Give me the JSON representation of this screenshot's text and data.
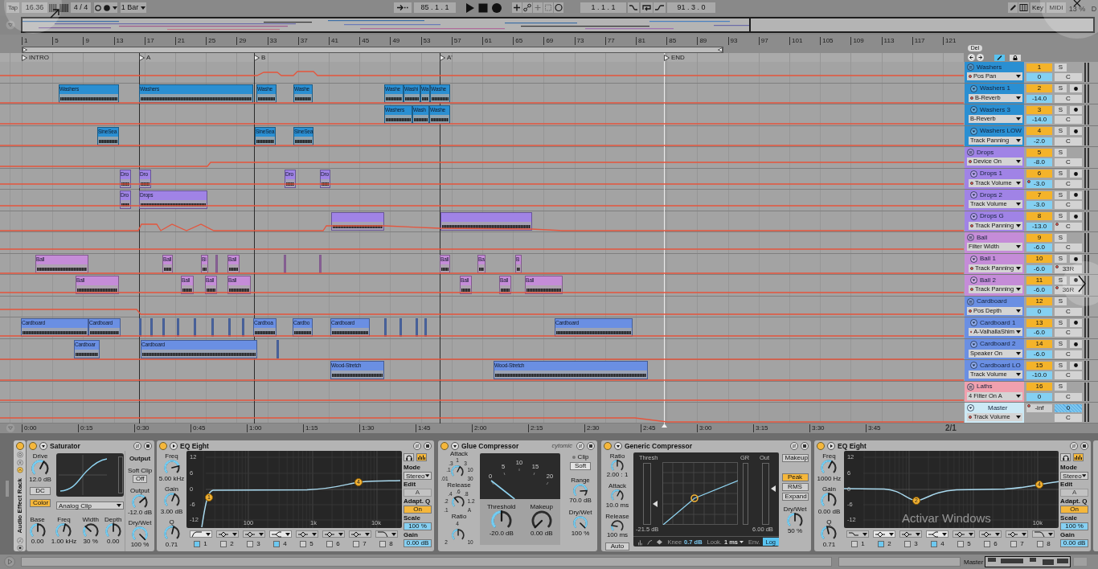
{
  "control_bar": {
    "tap": "Tap",
    "tempo": "16.36",
    "time_signature": "4 / 4",
    "quantization": "1 Bar",
    "position": "85 . 1 . 1",
    "loop_start": "1 . 1 . 1",
    "loop_length": "91 . 3 . 0",
    "key_button": "Key",
    "midi_button": "MIDI",
    "cpu_load": "13 %",
    "disk": "D"
  },
  "ruler": {
    "bars": [
      "1",
      "5",
      "9",
      "13",
      "17",
      "21",
      "25",
      "29",
      "33",
      "37",
      "41",
      "45",
      "49",
      "53",
      "57",
      "61",
      "65",
      "69",
      "73",
      "77",
      "81",
      "85",
      "89",
      "93",
      "97",
      "101",
      "105",
      "109",
      "113",
      "117",
      "121"
    ]
  },
  "locators": [
    "INTRO",
    "A",
    "B",
    "A'",
    "END"
  ],
  "header_tools": {
    "delete": "Del"
  },
  "tracks": [
    {
      "name": "Washers",
      "kind": "group",
      "color": "#2a8fd2",
      "automation": "Pos Pan",
      "automation_dot": true,
      "number": "1",
      "solo": "S",
      "volume": "0",
      "volume_dot": false,
      "pan": "C",
      "pan_dot": false
    },
    {
      "name": "Washers 1",
      "kind": "audio",
      "color": "#2a8fd2",
      "automation": "B-Reverb",
      "automation_dot": true,
      "number": "2",
      "solo": "S",
      "volume": "-14.0",
      "volume_dot": false,
      "pan": "C",
      "pan_dot": false,
      "clips": [
        {
          "kind": "clip",
          "name": "Washers"
        },
        {
          "kind": "clip",
          "name": "Washers"
        },
        {
          "kind": "clip",
          "name": "Washe"
        },
        {
          "kind": "clip",
          "name": "Washe"
        },
        {
          "kind": "clip",
          "name": "Washe"
        },
        {
          "kind": "clip",
          "name": "Washi"
        },
        {
          "kind": "clip",
          "name": "Wa"
        },
        {
          "kind": "clip",
          "name": "Washe"
        }
      ]
    },
    {
      "name": "Washers 3",
      "kind": "audio",
      "color": "#2a8fd2",
      "automation": "B-Reverb",
      "automation_dot": false,
      "number": "3",
      "solo": "S",
      "volume": "-14.0",
      "volume_dot": false,
      "pan": "C",
      "pan_dot": false,
      "clips": [
        {
          "kind": "clip",
          "name": "Washers"
        },
        {
          "kind": "clip",
          "name": "Wash"
        },
        {
          "kind": "clip",
          "name": "Washe"
        }
      ]
    },
    {
      "name": "Washers LOW",
      "kind": "audio",
      "color": "#2a8fd2",
      "automation": "Track Panning",
      "automation_dot": false,
      "number": "4",
      "solo": "S",
      "volume": "-2.0",
      "volume_dot": false,
      "pan": "C",
      "pan_dot": false,
      "clips": [
        {
          "kind": "clip",
          "name": "SineSea"
        },
        {
          "kind": "clip",
          "name": "SineSea"
        },
        {
          "kind": "clip",
          "name": "SineSea"
        }
      ]
    },
    {
      "name": "Drops",
      "kind": "group",
      "color": "#a083e6",
      "automation": "Device On",
      "automation_dot": true,
      "number": "5",
      "solo": "S",
      "volume": "-8.0",
      "volume_dot": false,
      "pan": "C",
      "pan_dot": false
    },
    {
      "name": "Drops 1",
      "kind": "audio",
      "color": "#a083e6",
      "automation": "Track Volume",
      "automation_dot": true,
      "number": "6",
      "solo": "S",
      "volume": "-3.0",
      "volume_dot": true,
      "pan": "C",
      "pan_dot": false,
      "clips": [
        {
          "kind": "clip",
          "name": "Dro"
        },
        {
          "kind": "clip",
          "name": "Dro"
        },
        {
          "kind": "clip",
          "name": "Dro"
        },
        {
          "kind": "clip",
          "name": "Dro"
        }
      ]
    },
    {
      "name": "Drops 2",
      "kind": "audio",
      "color": "#a083e6",
      "automation": "Track Volume",
      "automation_dot": false,
      "number": "7",
      "solo": "S",
      "volume": "-3.0",
      "volume_dot": false,
      "pan": "C",
      "pan_dot": false,
      "clips": [
        {
          "kind": "clip",
          "name": "Dro"
        },
        {
          "kind": "clip",
          "name": "Drops"
        }
      ]
    },
    {
      "name": "Drops G",
      "kind": "audio",
      "color": "#a083e6",
      "automation": "Track Panning",
      "automation_dot": true,
      "number": "8",
      "solo": "S",
      "volume": "-13.0",
      "volume_dot": false,
      "pan": "C",
      "pan_dot": true,
      "clips": [
        {
          "kind": "blank"
        },
        {
          "kind": "blank"
        }
      ]
    },
    {
      "name": "Ball",
      "kind": "group",
      "color": "#c58cd8",
      "automation": "Filter Width",
      "automation_dot": false,
      "number": "9",
      "solo": "S",
      "volume": "-6.0",
      "volume_dot": false,
      "pan": "C",
      "pan_dot": false
    },
    {
      "name": "Ball 1",
      "kind": "audio",
      "color": "#c58cd8",
      "automation": "Track Panning",
      "automation_dot": true,
      "number": "10",
      "solo": "S",
      "volume": "-6.0",
      "volume_dot": false,
      "pan": "33R",
      "pan_dot": true,
      "clips": [
        {
          "kind": "clip",
          "name": "Ball"
        },
        {
          "kind": "clip",
          "name": "Ball"
        },
        {
          "kind": "clip",
          "name": "Bi"
        },
        {
          "kind": "sliver"
        },
        {
          "kind": "clip",
          "name": "Ball"
        },
        {
          "kind": "sliver"
        },
        {
          "kind": "sliver"
        },
        {
          "kind": "clip",
          "name": "Ball"
        },
        {
          "kind": "clip",
          "name": "Ba"
        },
        {
          "kind": "clip",
          "name": "B"
        }
      ]
    },
    {
      "name": "Ball 2",
      "kind": "audio",
      "color": "#c58cd8",
      "automation": "Track Panning",
      "automation_dot": true,
      "number": "11",
      "solo": "S",
      "volume": "-6.0",
      "volume_dot": false,
      "pan": "36R",
      "pan_dot": true,
      "clips": [
        {
          "kind": "clip",
          "name": "Ball"
        },
        {
          "kind": "clip",
          "name": "Ball"
        },
        {
          "kind": "clip",
          "name": "Ball"
        },
        {
          "kind": "clip",
          "name": "Ball"
        },
        {
          "kind": "clip",
          "name": "Ball"
        },
        {
          "kind": "clip",
          "name": "Ball"
        },
        {
          "kind": "clip",
          "name": "Ball"
        }
      ]
    },
    {
      "name": "Cardboard",
      "kind": "group",
      "color": "#6a8fe3",
      "automation": "Pos Depth",
      "automation_dot": true,
      "number": "12",
      "solo": "S",
      "volume": "0",
      "volume_dot": false,
      "pan": "C",
      "pan_dot": false
    },
    {
      "name": "Cardboard 1",
      "kind": "audio",
      "color": "#6a8fe3",
      "automation": "A-ValhallaShim",
      "automation_dot": true,
      "number": "13",
      "solo": "S",
      "volume": "-6.0",
      "volume_dot": false,
      "pan": "C",
      "pan_dot": false,
      "clips": [
        {
          "kind": "clip",
          "name": "Cardboard"
        },
        {
          "kind": "clip",
          "name": "Cardboard"
        },
        {
          "kind": "sliver"
        },
        {
          "kind": "sliver"
        },
        {
          "kind": "sliver"
        },
        {
          "kind": "sliver"
        },
        {
          "kind": "sliver"
        },
        {
          "kind": "sliver"
        },
        {
          "kind": "sliver"
        },
        {
          "kind": "sliver"
        },
        {
          "kind": "clip",
          "name": "Cardboa"
        },
        {
          "kind": "clip",
          "name": "Cardbo"
        },
        {
          "kind": "clip",
          "name": "Cardboard"
        },
        {
          "kind": "sliver"
        },
        {
          "kind": "sliver"
        },
        {
          "kind": "sliver"
        },
        {
          "kind": "sliver"
        },
        {
          "kind": "clip",
          "name": "Cardboard"
        }
      ]
    },
    {
      "name": "Cardboard 2",
      "kind": "audio",
      "color": "#6a8fe3",
      "automation": "Speaker On",
      "automation_dot": false,
      "number": "14",
      "solo": "S",
      "volume": "-6.0",
      "volume_dot": false,
      "pan": "C",
      "pan_dot": false,
      "clips": [
        {
          "kind": "clip",
          "name": "Cardboar"
        },
        {
          "kind": "clip",
          "name": "Cardboard"
        },
        {
          "kind": "sliver"
        }
      ]
    },
    {
      "name": "Cardboard LO",
      "kind": "audio",
      "color": "#6a8fe3",
      "automation": "Track Volume",
      "automation_dot": false,
      "number": "15",
      "solo": "S",
      "volume": "-10.0",
      "volume_dot": false,
      "pan": "C",
      "pan_dot": false,
      "clips": [
        {
          "kind": "clip",
          "name": "Wood-Stretch"
        },
        {
          "kind": "clip",
          "name": "Wood-Stretch"
        }
      ]
    },
    {
      "name": "Laths",
      "kind": "group",
      "color": "#f1a0ae",
      "automation": "4 Filter On A",
      "automation_dot": false,
      "number": "16",
      "solo": "S",
      "volume": "0",
      "volume_dot": false,
      "pan": "C",
      "pan_dot": false
    }
  ],
  "master": {
    "name": "Master",
    "color": "#cce9f5",
    "automation": "Track Volume",
    "automation_dot": true,
    "peak": "-inf",
    "volume": "0",
    "pan": "C"
  },
  "time_ruler": {
    "times": [
      "0:00",
      "0:15",
      "0:30",
      "0:45",
      "1:00",
      "1:15",
      "1:30",
      "1:45",
      "2:00",
      "2:15",
      "2:30",
      "2:45",
      "3:00",
      "3:15",
      "3:30",
      "3:45"
    ],
    "zoom": "2/1"
  },
  "rack": {
    "title": "Audio Effect Rack",
    "on": true
  },
  "devices": [
    {
      "kind": "saturator",
      "title": "Saturator",
      "on": true,
      "drive": {
        "label": "Drive",
        "value": "12.0 dB"
      },
      "dc": {
        "label": "DC",
        "on": false
      },
      "color_mode": {
        "label": "Color",
        "on": true
      },
      "curve_type": "Analog Clip",
      "output_title": "Output",
      "soft_clip": {
        "label": "Soft Clip",
        "value": "Off"
      },
      "output": {
        "label": "Output",
        "value": "-12.0 dB"
      },
      "dry_wet": {
        "label": "Dry/Wet",
        "value": "100 %"
      },
      "knobs": [
        {
          "label": "Base",
          "value": "0.00"
        },
        {
          "label": "Freq",
          "value": "1.00 kHz"
        },
        {
          "label": "Width",
          "value": "30 %"
        },
        {
          "label": "Depth",
          "value": "0.00"
        }
      ]
    },
    {
      "kind": "eq_eight",
      "title": "EQ Eight",
      "on": true,
      "knobs": [
        {
          "label": "Freq",
          "value": "5.00 kHz"
        },
        {
          "label": "Gain",
          "value": "3.00 dB"
        },
        {
          "label": "Q",
          "value": "0.71"
        }
      ],
      "y_labels": [
        "12",
        "6",
        "0",
        "-6",
        "-12"
      ],
      "x_labels": [
        "100",
        "1k",
        "10k"
      ],
      "points": [
        "1",
        "4"
      ],
      "bands": [
        {
          "number": "1",
          "kind": "low_cut",
          "on": true
        },
        {
          "number": "2",
          "kind": "bell",
          "on": false
        },
        {
          "number": "3",
          "kind": "bell",
          "on": false
        },
        {
          "number": "4",
          "kind": "high_shelf",
          "on": true
        },
        {
          "number": "5",
          "kind": "bell",
          "on": false
        },
        {
          "number": "6",
          "kind": "bell",
          "on": false
        },
        {
          "number": "7",
          "kind": "bell",
          "on": false
        },
        {
          "number": "8",
          "kind": "high_cut",
          "on": false
        }
      ],
      "spectrum_on": true,
      "mode": {
        "label": "Mode",
        "value": "Stereo"
      },
      "edit": {
        "label": "Edit",
        "value": "A",
        "disabled": true
      },
      "adaptive_q": {
        "label": "Adapt. Q",
        "value": "On",
        "on": true
      },
      "scale": {
        "label": "Scale",
        "value": "100 %"
      },
      "gain": {
        "label": "Gain",
        "value": "0.00 dB"
      }
    },
    {
      "kind": "glue_compressor",
      "title": "Glue Compressor",
      "logo": "cytomic",
      "on": true,
      "dials": [
        {
          "label": "Attack",
          "scale": [
            ".01",
            ".1",
            ".3",
            "1",
            "3",
            "10",
            "30"
          ]
        },
        {
          "label": "Release",
          "scale": [
            ".1",
            ".2",
            ".4",
            ".6",
            ".8",
            "1.2",
            "A"
          ]
        },
        {
          "label": "Ratio",
          "scale": [
            "2",
            "4",
            "10"
          ]
        }
      ],
      "meter": {
        "scale": [
          "0",
          "5",
          "10",
          "15",
          "20"
        ]
      },
      "threshold": {
        "label": "Threshold",
        "value": "-20.0 dB"
      },
      "makeup": {
        "label": "Makeup",
        "value": "0.00 dB"
      },
      "clip": {
        "label": "Clip",
        "value": "Soft"
      },
      "range": {
        "label": "Range",
        "value": "70.0 dB"
      },
      "dry_wet": {
        "label": "Dry/Wet",
        "value": "100 %"
      }
    },
    {
      "kind": "compressor",
      "title": "Generic Compressor",
      "on": true,
      "knobs": [
        {
          "label": "Ratio",
          "value": "2.00 : 1"
        },
        {
          "label": "Attack",
          "value": "10.0 ms"
        },
        {
          "label": "Release",
          "value": "100 ms"
        }
      ],
      "auto": {
        "label": "Auto",
        "on": false
      },
      "display": {
        "thresh_label": "Thresh",
        "gr_label": "GR",
        "out_label": "Out",
        "thresh_value": "-21.5 dB",
        "out_value": "6.00 dB"
      },
      "knee": {
        "label": "Knee",
        "value": "0.7 dB"
      },
      "lookahead": {
        "label": "Look.",
        "value": "1 ms"
      },
      "envelope": {
        "label": "Env.",
        "value": "Log",
        "on": true
      },
      "makeup": {
        "label": "Makeup",
        "on": false
      },
      "modes": [
        {
          "label": "Peak",
          "selected": true
        },
        {
          "label": "RMS",
          "selected": false
        },
        {
          "label": "Expand",
          "selected": false
        }
      ],
      "dry_wet": {
        "label": "Dry/Wet",
        "value": "50 %"
      }
    },
    {
      "kind": "eq_eight",
      "title": "EQ Eight",
      "on": true,
      "knobs": [
        {
          "label": "Freq",
          "value": "1000 Hz"
        },
        {
          "label": "Gain",
          "value": "0.00 dB"
        },
        {
          "label": "Q",
          "value": "0.71"
        }
      ],
      "y_labels": [
        "12",
        "6",
        "0",
        "-6",
        "-12"
      ],
      "x_labels": [
        "10k"
      ],
      "points": [
        "2",
        "4"
      ],
      "bands": [
        {
          "number": "1",
          "kind": "low_shelf",
          "on": false
        },
        {
          "number": "2",
          "kind": "bell",
          "on": true
        },
        {
          "number": "3",
          "kind": "bell",
          "on": false
        },
        {
          "number": "4",
          "kind": "high_shelf",
          "on": true
        },
        {
          "number": "5",
          "kind": "bell",
          "on": false
        },
        {
          "number": "6",
          "kind": "bell",
          "on": false
        },
        {
          "number": "7",
          "kind": "bell",
          "on": false
        },
        {
          "number": "8",
          "kind": "high_cut",
          "on": false
        }
      ],
      "spectrum_on": true,
      "mode": {
        "label": "Mode",
        "value": "Stereo"
      },
      "edit": {
        "label": "Edit",
        "value": "A",
        "disabled": true
      },
      "adaptive_q": {
        "label": "Adapt. Q",
        "value": "On",
        "on": true
      },
      "scale": {
        "label": "Scale",
        "value": "100 %"
      },
      "gain": {
        "label": "Gain",
        "value": "0.00 dB"
      }
    }
  ],
  "status_bar": {
    "track_label": "Master"
  },
  "os_notice": "Activar Windows"
}
